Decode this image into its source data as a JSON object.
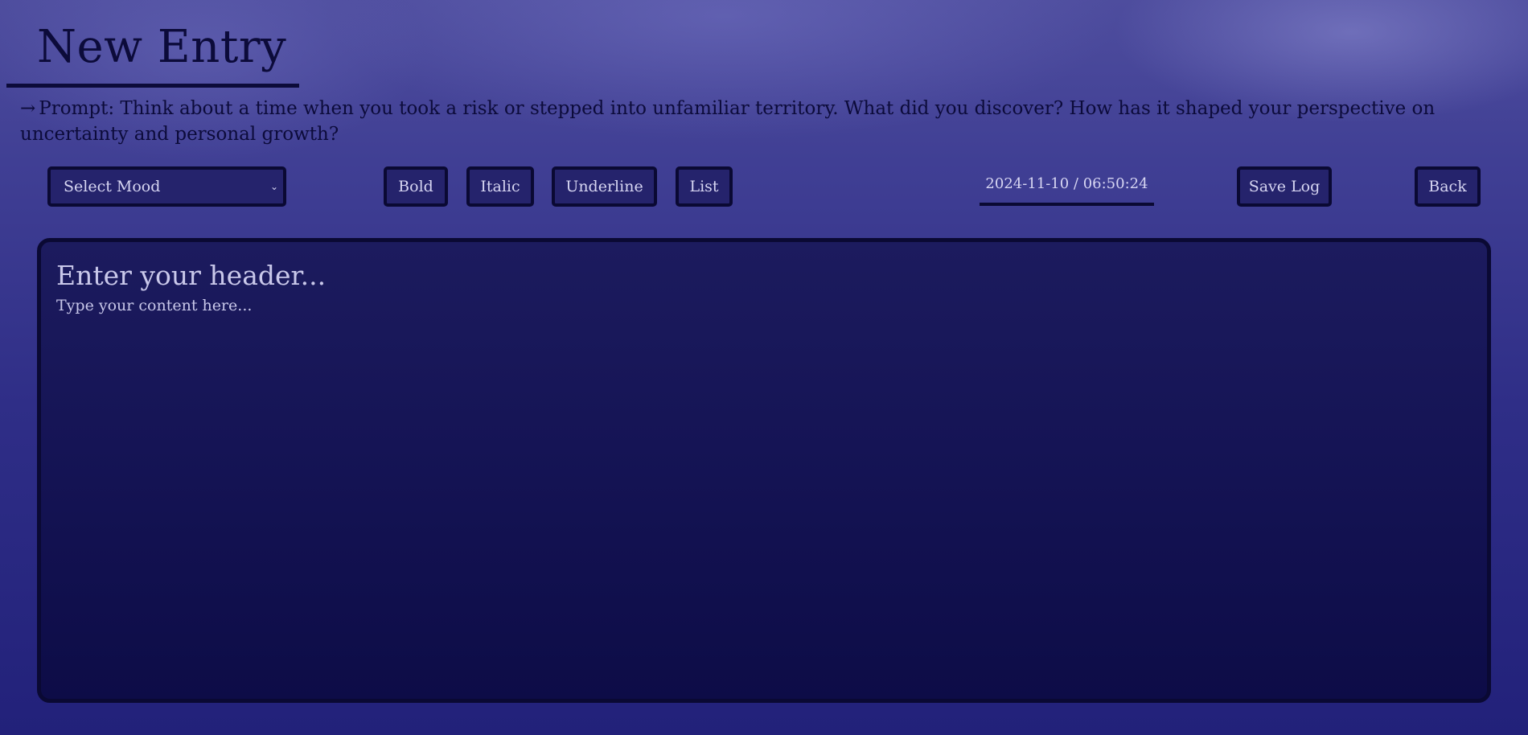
{
  "page": {
    "title": "New Entry",
    "prompt_arrow": "→",
    "prompt_text": "Prompt: Think about a time when you took a risk or stepped into unfamiliar territory. What did you discover? How has it shaped your perspective on uncertainty and personal growth?"
  },
  "toolbar": {
    "mood_select": {
      "selected": "Select Mood",
      "chevron": "⌄"
    },
    "bold_label": "Bold",
    "italic_label": "Italic",
    "underline_label": "Underline",
    "list_label": "List",
    "timestamp": "2024-11-10 / 06:50:24",
    "save_label": "Save Log",
    "back_label": "Back"
  },
  "editor": {
    "header_placeholder": "Enter your header...",
    "content_placeholder": "Type your content here..."
  },
  "colors": {
    "background_top": "#4e4d9e",
    "background_bottom": "#22217a",
    "text_dark": "#0c0b3a",
    "control_fill": "#25236c",
    "control_text": "#d7d6f2",
    "editor_fill": "#151455"
  }
}
